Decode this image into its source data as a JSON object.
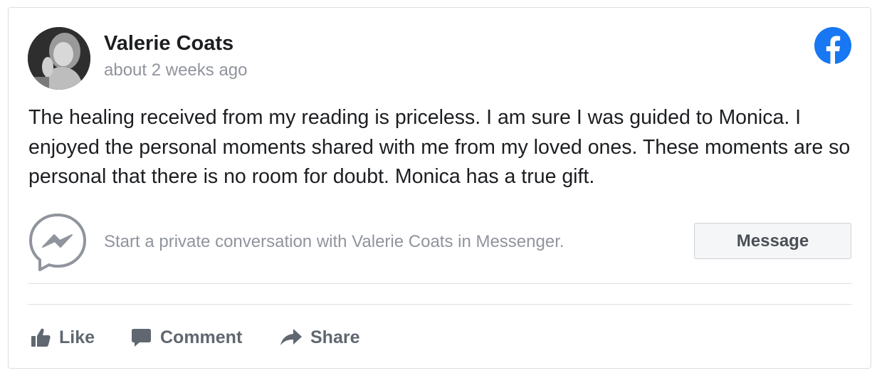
{
  "post": {
    "author": "Valerie Coats",
    "timestamp": "about 2 weeks ago",
    "text": "The healing received from my reading is priceless. I am sure I was guided to Monica. I enjoyed the personal moments shared with me from my loved ones. These moments are so personal that there is no room for doubt. Monica has a true gift.",
    "platform_icon": "facebook-icon",
    "brand_color": "#1877f2"
  },
  "messenger": {
    "icon": "messenger-icon",
    "prompt": "Start a private conversation with Valerie Coats in Messenger.",
    "button_label": "Message"
  },
  "actions": {
    "like": {
      "label": "Like",
      "icon": "thumbs-up-icon"
    },
    "comment": {
      "label": "Comment",
      "icon": "comment-bubble-icon"
    },
    "share": {
      "label": "Share",
      "icon": "share-arrow-icon"
    }
  }
}
